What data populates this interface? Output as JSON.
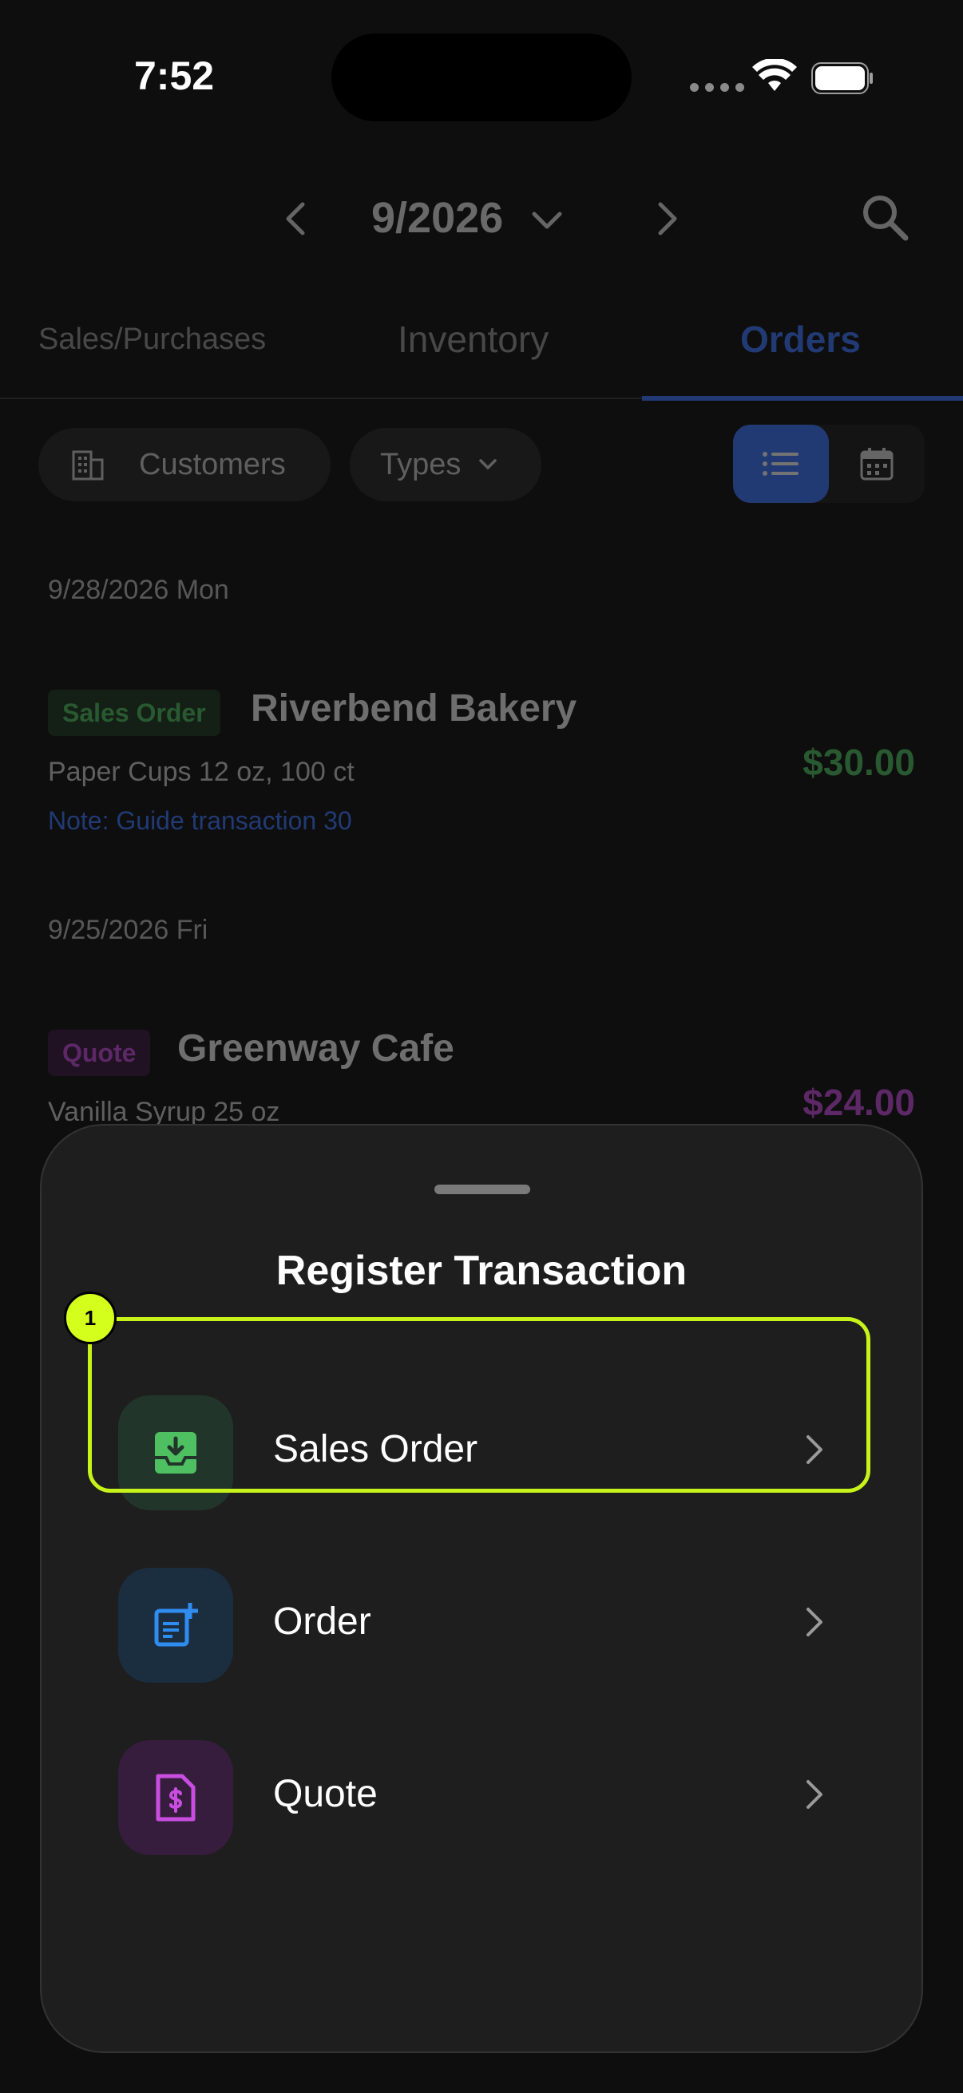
{
  "status_bar": {
    "time": "7:52"
  },
  "header": {
    "month": "9/2026"
  },
  "tabs": [
    {
      "label": "Sales/Purchases"
    },
    {
      "label": "Inventory"
    },
    {
      "label": "Orders"
    }
  ],
  "filters": {
    "customers_label": "Customers",
    "types_label": "Types"
  },
  "groups": [
    {
      "date": "9/28/2026 Mon",
      "orders": [
        {
          "badge": "Sales Order",
          "name": "Riverbend Bakery",
          "item": "Paper Cups 12 oz, 100 ct",
          "note": "Note: Guide transaction 30",
          "amount": "$30.00"
        }
      ]
    },
    {
      "date": "9/25/2026 Fri",
      "orders": [
        {
          "badge": "Quote",
          "name": "Greenway Cafe",
          "item": "Vanilla Syrup 25 oz",
          "amount": "$24.00"
        }
      ]
    }
  ],
  "sheet": {
    "title": "Register Transaction",
    "options": [
      {
        "label": "Sales Order"
      },
      {
        "label": "Order"
      },
      {
        "label": "Quote"
      }
    ]
  },
  "annotation": {
    "marker": "1"
  },
  "colors": {
    "accent": "#3e78ff",
    "sales": "#4fc062",
    "quote": "#c94ee0",
    "order": "#2f8cf0",
    "highlight": "#c8f31a"
  }
}
